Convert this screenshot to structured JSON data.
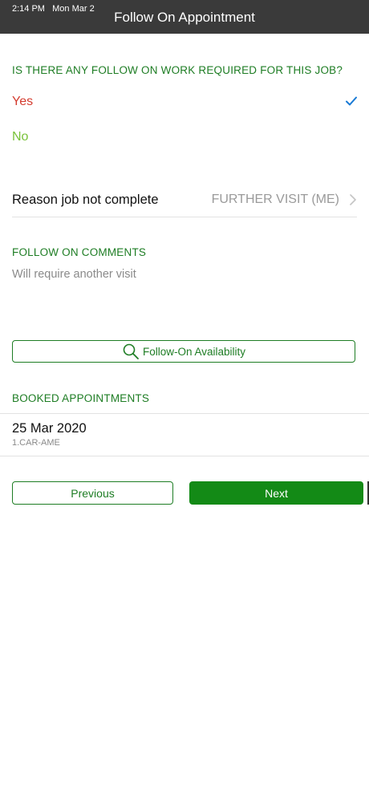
{
  "status_bar": {
    "time_date": "2:14 PM   Mon Mar 2"
  },
  "header": {
    "title": "Follow On Appointment"
  },
  "follow_on_question": {
    "label": "IS THERE ANY FOLLOW ON WORK REQUIRED FOR THIS JOB?",
    "options": [
      {
        "label": "Yes",
        "selected": true,
        "color": "#d43c2f"
      },
      {
        "label": "No",
        "selected": false,
        "color": "#79c23a"
      }
    ]
  },
  "reason": {
    "label": "Reason job not complete",
    "value": "FURTHER VISIT (ME)"
  },
  "comments": {
    "label": "FOLLOW ON COMMENTS",
    "value": "Will require another visit"
  },
  "availability_button": {
    "label": "Follow-On Availability",
    "icon": "search-icon"
  },
  "booked": {
    "label": "BOOKED APPOINTMENTS",
    "items": [
      {
        "date": "25 Mar 2020",
        "code": "1.CAR-AME"
      }
    ]
  },
  "navigation": {
    "previous_label": "Previous",
    "next_label": "Next"
  },
  "colors": {
    "accent_green": "#1e7d24",
    "next_green": "#138a16",
    "check_blue": "#1a7bd5",
    "header_bg": "#3a3a3a"
  }
}
